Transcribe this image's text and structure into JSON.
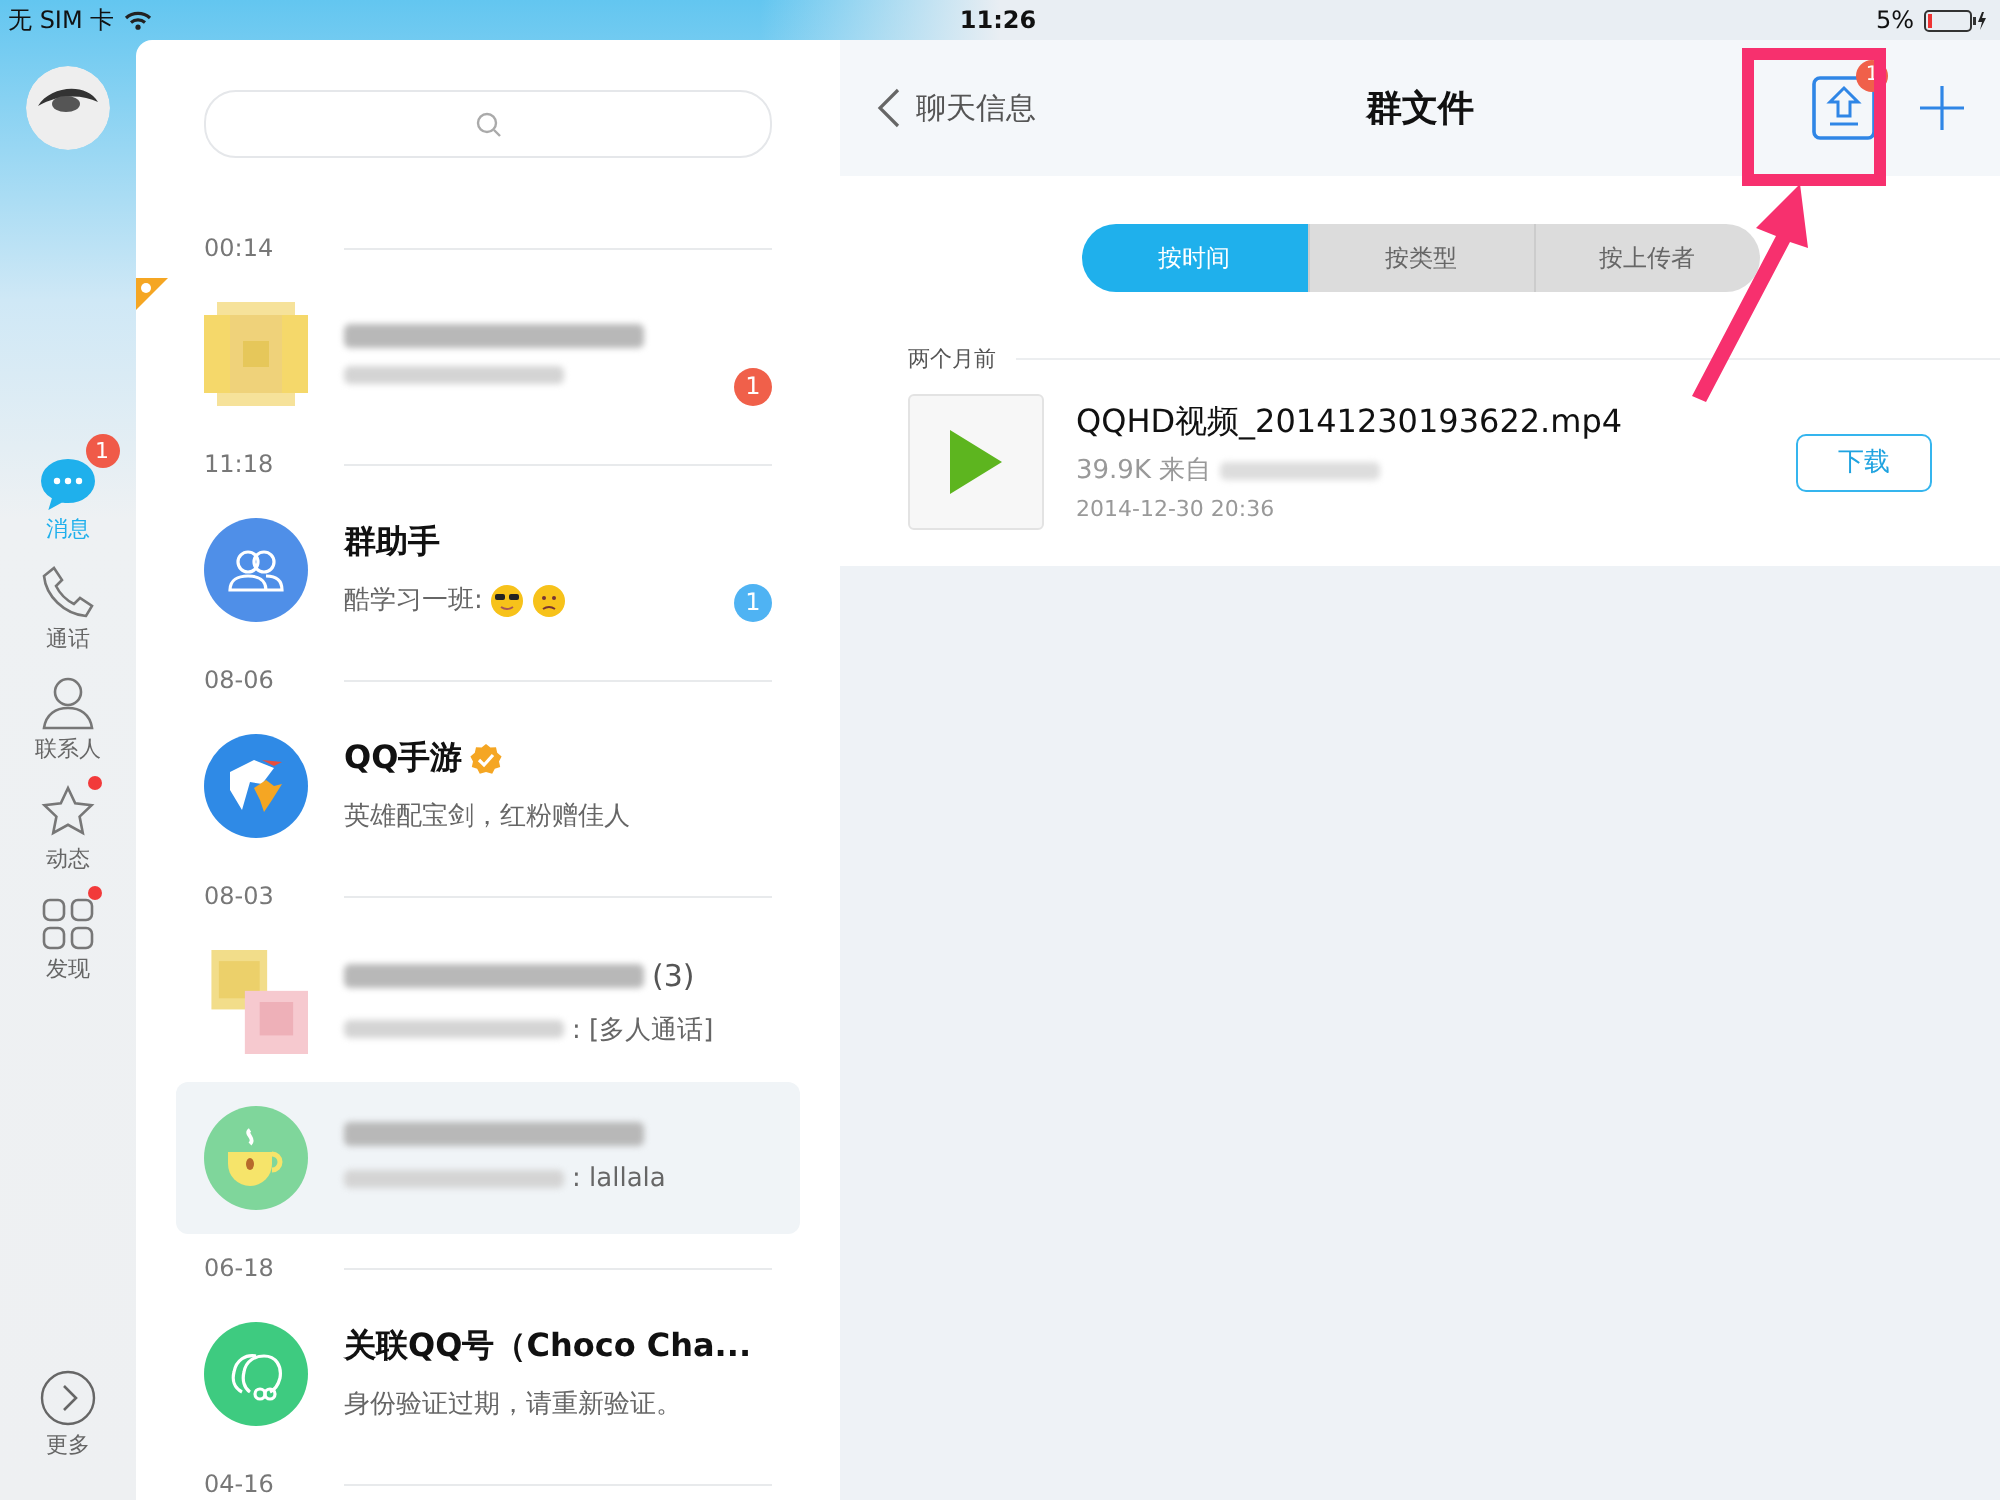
{
  "status_bar": {
    "carrier": "无 SIM 卡",
    "time": "11:26",
    "battery": "5%"
  },
  "rail": {
    "items": [
      {
        "label": "消息",
        "selected": true,
        "badge": "1"
      },
      {
        "label": "通话",
        "selected": false
      },
      {
        "label": "联系人",
        "selected": false
      },
      {
        "label": "动态",
        "selected": false,
        "dot": true
      },
      {
        "label": "发现",
        "selected": false,
        "dot": true
      }
    ],
    "more": "更多"
  },
  "chat_list": {
    "groups": [
      {
        "time": "00:14",
        "chats": [
          {
            "kind": "mosaic-yellow",
            "name_blurred": true,
            "preview_blurred": true,
            "badge": "1",
            "badge_muted": false,
            "pinned": true,
            "selected": false
          }
        ]
      },
      {
        "time": "11:18",
        "chats": [
          {
            "kind": "group-assistant",
            "name": "群助手",
            "preview": "酷学习一班:",
            "emoji": [
              {
                "kind": "cool"
              },
              {
                "kind": "sad"
              }
            ],
            "badge": "1",
            "badge_muted": true,
            "selected": false
          }
        ]
      },
      {
        "time": "08-06",
        "chats": [
          {
            "kind": "game",
            "name": "QQ手游",
            "verified": true,
            "preview": "英雄配宝剑，红粉赠佳人",
            "selected": false
          }
        ]
      },
      {
        "time": "08-03",
        "chats": [
          {
            "kind": "mosaic-mixed",
            "name_blurred": true,
            "name_suffix": "(3)",
            "preview_blurred": true,
            "preview": ": [多人通话]",
            "selected": false
          },
          {
            "kind": "cup",
            "name_blurred": true,
            "preview_blurred": true,
            "preview": ": lallala",
            "selected": true
          }
        ]
      },
      {
        "time": "06-18",
        "chats": [
          {
            "kind": "link",
            "name": "关联QQ号（Choco Cha...",
            "preview": "身份验证过期，请重新验证。",
            "selected": false
          }
        ]
      },
      {
        "time": "04-16"
      }
    ]
  },
  "header": {
    "back": "聊天信息",
    "title": "群文件",
    "upload_badge": "1"
  },
  "tabs": [
    {
      "label": "按时间",
      "selected": true
    },
    {
      "label": "按类型",
      "selected": false
    },
    {
      "label": "按上传者",
      "selected": false
    }
  ],
  "sections": [
    {
      "label": "两个月前",
      "files": [
        {
          "name": "QQHD视频_20141230193622.mp4",
          "size": "39.9K 来自",
          "uploader_blurred": true,
          "date": "2014-12-30 20:36",
          "button": "下载"
        }
      ]
    }
  ]
}
